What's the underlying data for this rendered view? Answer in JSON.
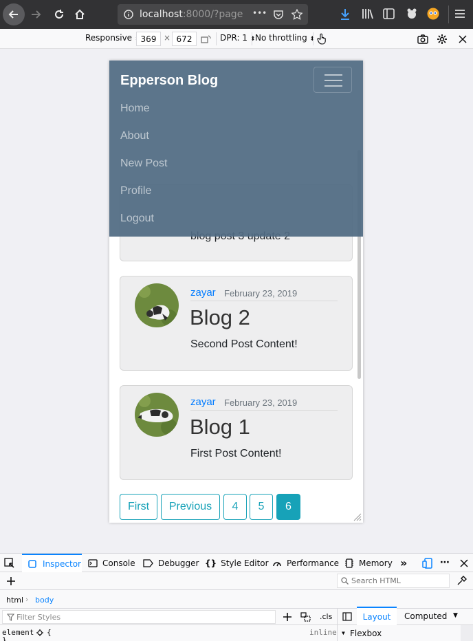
{
  "browser": {
    "url_host": "localhost",
    "url_rest": ":8000/?page",
    "menu_dots": "•••"
  },
  "rdm": {
    "device": "Responsive",
    "width": "369",
    "times": "×",
    "height": "672",
    "dpr": "DPR: 1",
    "throttling": "No throttling"
  },
  "site": {
    "brand": "Epperson Blog",
    "nav": [
      "Home",
      "About",
      "New Post",
      "Profile",
      "Logout"
    ],
    "partial_post_text": "blog post 3 update 2",
    "posts": [
      {
        "author": "zayar",
        "date": "February 23, 2019",
        "title": "Blog 2",
        "content": "Second Post Content!"
      },
      {
        "author": "zayar",
        "date": "February 23, 2019",
        "title": "Blog 1",
        "content": "First Post Content!"
      }
    ],
    "pagination": {
      "first": "First",
      "previous": "Previous",
      "pages": [
        "4",
        "5",
        "6"
      ],
      "active_page": "6"
    }
  },
  "devtools": {
    "tabs": {
      "inspector": "Inspector",
      "console": "Console",
      "debugger": "Debugger",
      "style_editor": "Style Editor",
      "performance": "Performance",
      "memory": "Memory"
    },
    "search_placeholder": "Search HTML",
    "breadcrumbs": [
      "html",
      "body"
    ],
    "filter_placeholder": "Filter Styles",
    "cls": ".cls",
    "layout_tab": "Layout",
    "computed_tab": "Computed",
    "flexbox": "Flexbox",
    "rule_selector": "element",
    "rule_open": "{",
    "rule_inline": "inline",
    "rule_close": "}"
  },
  "colors": {
    "navbar": "#506b82",
    "link": "#007bff",
    "pager": "#17a2b8",
    "devtools_accent": "#0a84ff"
  }
}
